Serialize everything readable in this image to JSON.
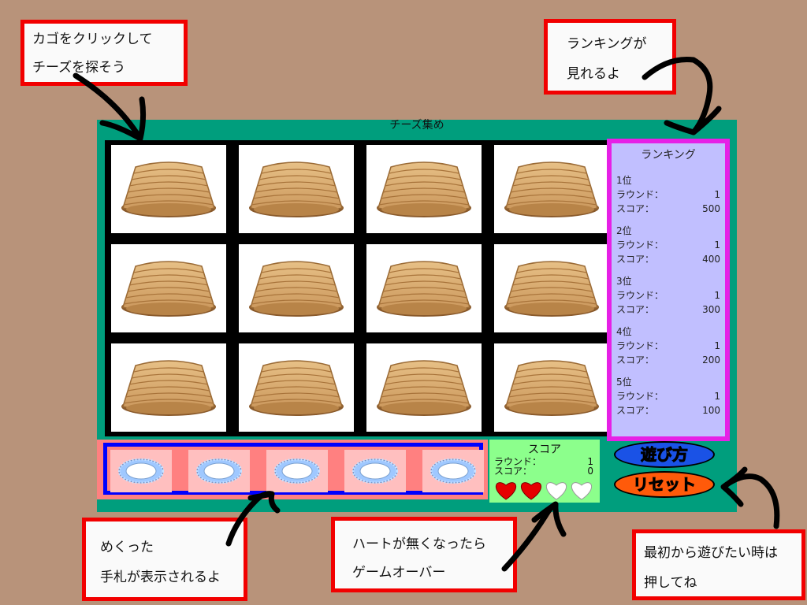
{
  "callouts": {
    "basket_hint": [
      "カゴをクリックして",
      "チーズを探そう"
    ],
    "ranking_hint": [
      "ランキングが",
      "見れるよ"
    ],
    "hand_hint": [
      "めくった",
      "手札が表示されるよ"
    ],
    "heart_hint": [
      "ハートが無くなったら",
      "ゲームオーバー"
    ],
    "reset_hint": [
      "最初から遊びたい時は",
      "押してね"
    ]
  },
  "game": {
    "title": "チーズ集め",
    "basket_count": 12
  },
  "ranking": {
    "title": "ランキング",
    "round_label": "ラウンド：",
    "score_label": "スコア：",
    "entries": [
      {
        "rank": "1位",
        "round": "1",
        "score": "500"
      },
      {
        "rank": "2位",
        "round": "1",
        "score": "400"
      },
      {
        "rank": "3位",
        "round": "1",
        "score": "300"
      },
      {
        "rank": "4位",
        "round": "1",
        "score": "200"
      },
      {
        "rank": "5位",
        "round": "1",
        "score": "100"
      }
    ]
  },
  "score": {
    "title": "スコア",
    "round_label": "ラウンド：",
    "round_value": "1",
    "score_label": "スコア：",
    "score_value": "0",
    "hearts_total": 4,
    "hearts_filled": 2
  },
  "buttons": {
    "howto": "遊び方",
    "reset": "リセット"
  },
  "hand": {
    "plate_count": 5
  },
  "colors": {
    "background": "#b8937a",
    "game_green": "#009e7d",
    "callout_border": "#f20000",
    "ranking_bg": "#c1bfff",
    "ranking_border": "#e620e6",
    "hand_border": "#0000ff",
    "score_bg": "#8cff8c",
    "heart_red": "#e60000"
  }
}
